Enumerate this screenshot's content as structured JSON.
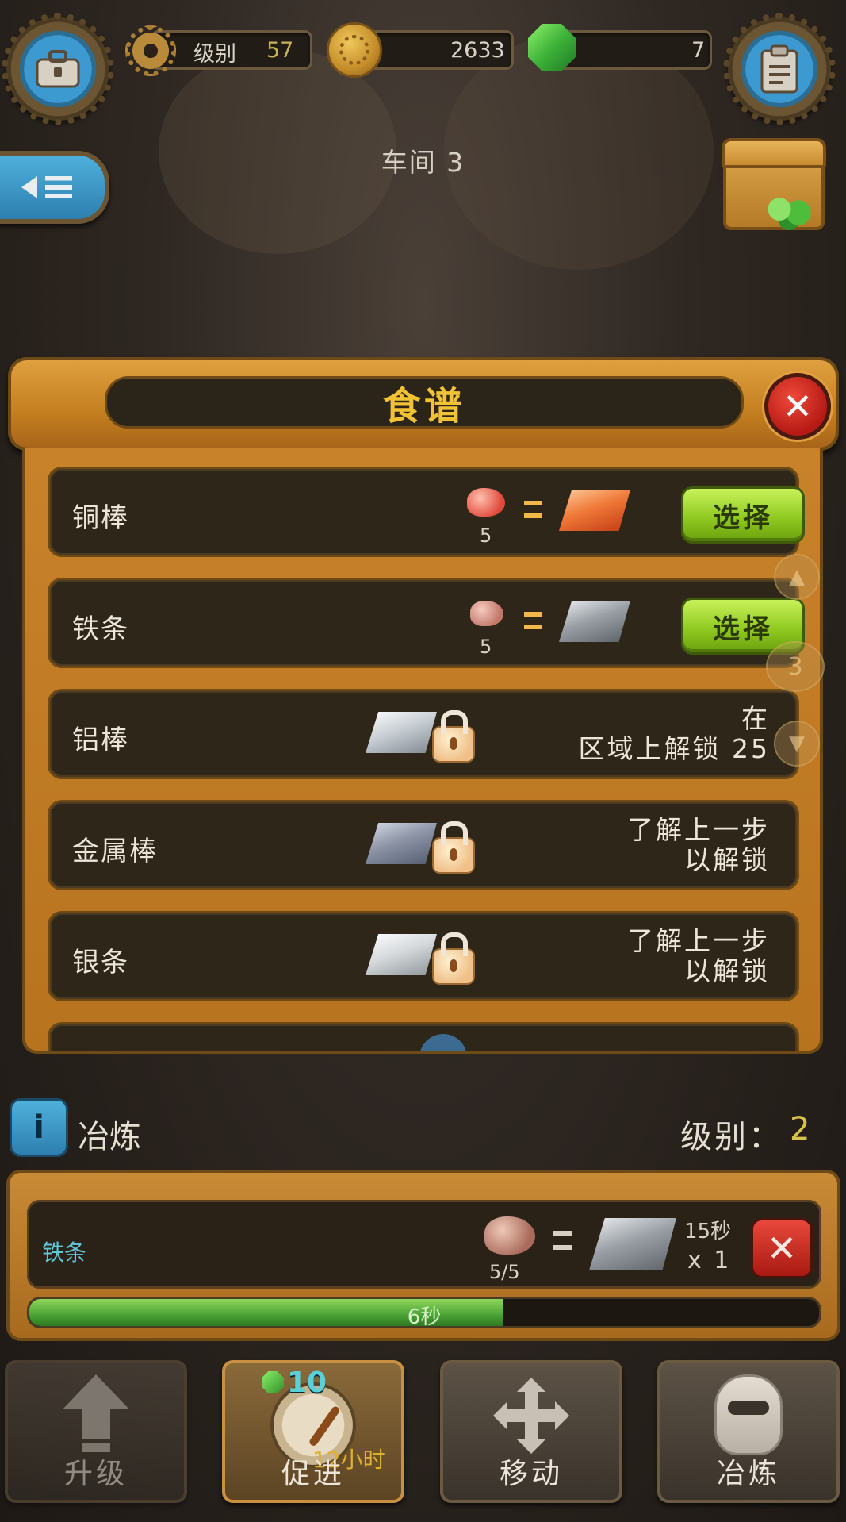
{
  "hud": {
    "level_label": "级别",
    "level_value": "57",
    "coins": "2633",
    "gems": "7"
  },
  "workshop": {
    "title": "车间 3"
  },
  "recipe_panel": {
    "title": "食谱",
    "recipes": [
      {
        "name": "铜棒",
        "input_count": "5",
        "action": "选择",
        "state": "available"
      },
      {
        "name": "铁条",
        "input_count": "5",
        "action": "选择",
        "state": "available"
      },
      {
        "name": "铝棒",
        "unlock_line1": "在",
        "unlock_line2": "区域上解锁 25",
        "state": "locked"
      },
      {
        "name": "金属棒",
        "unlock_line1": "了解上一步",
        "unlock_line2": "以解锁",
        "state": "locked"
      },
      {
        "name": "银条",
        "unlock_line1": "了解上一步",
        "unlock_line2": "以解锁",
        "state": "locked"
      }
    ],
    "page_indicator": "3"
  },
  "smelter": {
    "label": "冶炼",
    "level_label": "级别：",
    "level_value": "2",
    "queue": {
      "item_name": "铁条",
      "input_count": "5/5",
      "duration": "15秒",
      "multiplier": "x 1",
      "progress_text": "6秒",
      "progress_fraction": 0.6
    }
  },
  "actions": {
    "upgrade": "升级",
    "boost": "促进",
    "boost_cost": "10",
    "boost_time": "12小时",
    "move": "移动",
    "smelt": "冶炼"
  },
  "colors": {
    "accent_gold": "#f0c234",
    "select_green": "#8cc61e",
    "close_red": "#d0281e",
    "progress_green": "#4aa236",
    "queue_name_cyan": "#5cc8d8"
  }
}
